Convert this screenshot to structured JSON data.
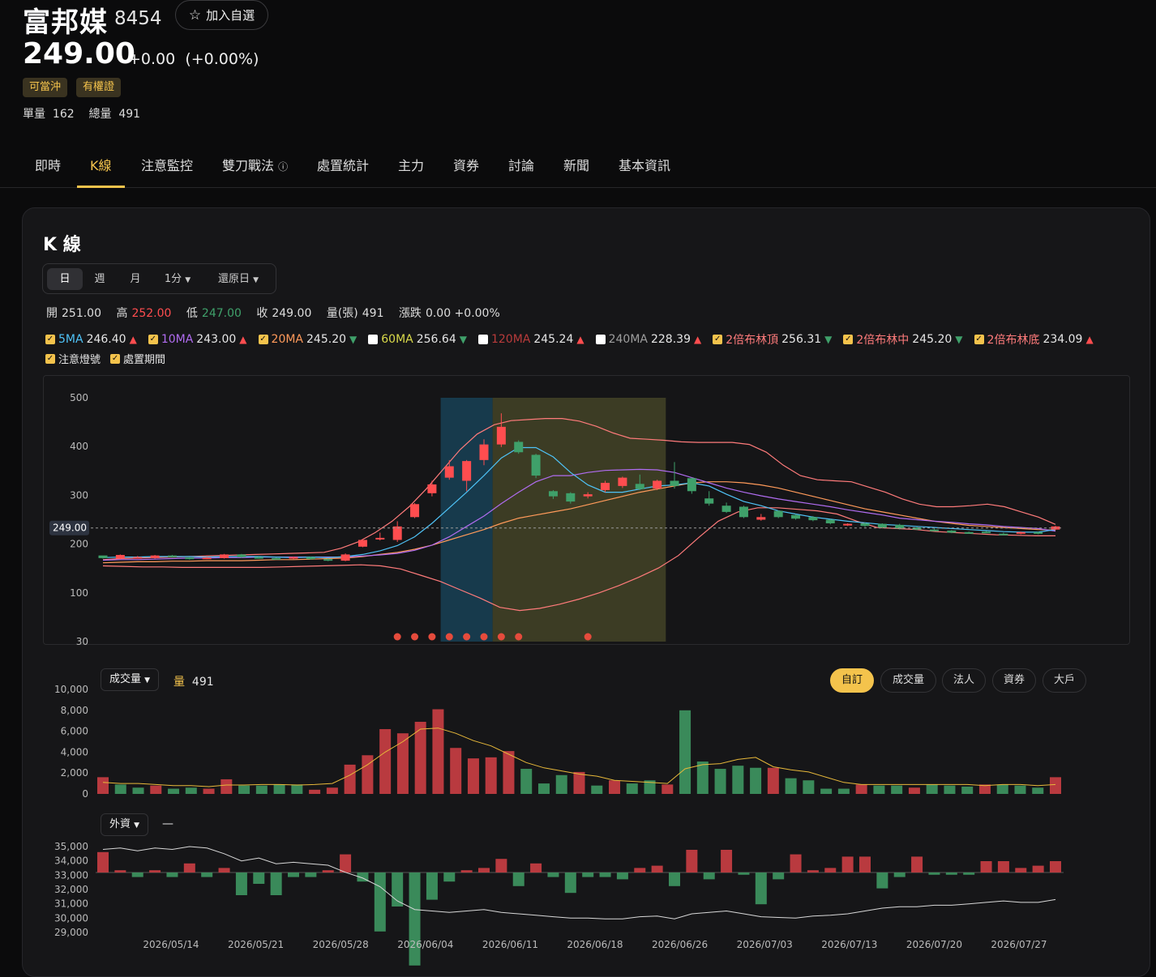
{
  "stock": {
    "name": "富邦媒",
    "code": "8454",
    "add_watch": "加入自選",
    "price": "249.00",
    "change": "+0.00",
    "change_pct": "(+0.00%)"
  },
  "badges": [
    "可當沖",
    "有權證"
  ],
  "volume": {
    "single_label": "單量",
    "single": "162",
    "total_label": "總量",
    "total": "491"
  },
  "tabs": [
    "即時",
    "K線",
    "注意監控",
    "雙刀戰法",
    "處置統計",
    "主力",
    "資券",
    "討論",
    "新聞",
    "基本資訊"
  ],
  "active_tab": "K線",
  "kline": {
    "title": "K 線",
    "periods": [
      "日",
      "週",
      "月",
      "1分",
      "還原日"
    ],
    "ohlc": {
      "open_label": "開",
      "open": "251.00",
      "high_label": "高",
      "high": "252.00",
      "low_label": "低",
      "low": "247.00",
      "close_label": "收",
      "close": "249.00",
      "vol_label": "量(張)",
      "vol": "491",
      "chg_label": "漲跌",
      "chg": "0.00 +0.00%"
    },
    "indicators": [
      {
        "name": "5MA",
        "value": "246.40",
        "dir": "up",
        "checked": true,
        "color": "#4fc3f7"
      },
      {
        "name": "10MA",
        "value": "243.00",
        "dir": "up",
        "checked": true,
        "color": "#b06cf0"
      },
      {
        "name": "20MA",
        "value": "245.20",
        "dir": "down",
        "checked": true,
        "color": "#ff9a5a"
      },
      {
        "name": "60MA",
        "value": "256.64",
        "dir": "down",
        "checked": false,
        "color": "#d9d94a"
      },
      {
        "name": "120MA",
        "value": "245.24",
        "dir": "up",
        "checked": false,
        "color": "#b83b3b"
      },
      {
        "name": "240MA",
        "value": "228.39",
        "dir": "up",
        "checked": false,
        "color": "#9e9e9e"
      },
      {
        "name": "2倍布林頂",
        "value": "256.31",
        "dir": "down",
        "checked": true,
        "color": "#ff7b7b"
      },
      {
        "name": "2倍布林中",
        "value": "245.20",
        "dir": "down",
        "checked": true,
        "color": "#ff7b7b"
      },
      {
        "name": "2倍布林底",
        "value": "234.09",
        "dir": "up",
        "checked": true,
        "color": "#ff7b7b"
      }
    ],
    "extra_toggles": [
      "注意燈號",
      "處置期間"
    ],
    "current_price_tag": "249.00"
  },
  "volume_panel": {
    "selector": "成交量",
    "label": "量",
    "value": "491",
    "tabs": [
      "自訂",
      "成交量",
      "法人",
      "資券",
      "大戶"
    ],
    "active": "自訂"
  },
  "foreign_panel": {
    "selector": "外資",
    "value": "—"
  },
  "colors": {
    "up": "#ff4d4f",
    "down": "#3fa06a",
    "accent": "#f4c34c",
    "band_warn": "#4a4a2a",
    "band_alert": "#173a4c"
  },
  "chart_data": [
    {
      "type": "candlestick",
      "y_ticks": [
        "500",
        "400",
        "300",
        "200",
        "100",
        "30"
      ],
      "x_labels": [
        "2026/05/14",
        "2026/05/21",
        "2026/05/28",
        "2026/06/04",
        "2026/06/11",
        "2026/06/18",
        "2026/06/26",
        "2026/07/03",
        "2026/07/13",
        "2026/07/20",
        "2026/07/27"
      ],
      "candles": [
        [
          196,
          191,
          194,
          190
        ],
        [
          190,
          197,
          198,
          189
        ],
        [
          193,
          193,
          195,
          191
        ],
        [
          191,
          196,
          197,
          190
        ],
        [
          196,
          194,
          197,
          192
        ],
        [
          192,
          190,
          193,
          188
        ],
        [
          190,
          192,
          193,
          189
        ],
        [
          191,
          198,
          199,
          190
        ],
        [
          198,
          193,
          199,
          191
        ],
        [
          193,
          191,
          194,
          190
        ],
        [
          191,
          190,
          192,
          189
        ],
        [
          190,
          193,
          194,
          189
        ],
        [
          193,
          189,
          194,
          188
        ],
        [
          189,
          186,
          190,
          185
        ],
        [
          186,
          198,
          200,
          185
        ],
        [
          213,
          226,
          228,
          212
        ],
        [
          228,
          230,
          240,
          225
        ],
        [
          226,
          252,
          262,
          222
        ],
        [
          270,
          295,
          297,
          268
        ],
        [
          316,
          333,
          340,
          310
        ],
        [
          346,
          368,
          380,
          342
        ],
        [
          340,
          378,
          380,
          320
        ],
        [
          380,
          410,
          420,
          370
        ],
        [
          410,
          444,
          470,
          405
        ],
        [
          415,
          395,
          418,
          392
        ],
        [
          390,
          350,
          392,
          345
        ],
        [
          320,
          310,
          322,
          305
        ],
        [
          316,
          300,
          318,
          296
        ],
        [
          310,
          314,
          318,
          306
        ],
        [
          322,
          336,
          340,
          318
        ],
        [
          330,
          346,
          348,
          326
        ],
        [
          334,
          324,
          352,
          322
        ],
        [
          325,
          340,
          342,
          322
        ],
        [
          340,
          330,
          376,
          325
        ],
        [
          345,
          320,
          346,
          315
        ],
        [
          306,
          296,
          320,
          292
        ],
        [
          292,
          280,
          298,
          278
        ],
        [
          290,
          270,
          292,
          268
        ],
        [
          265,
          270,
          276,
          263
        ],
        [
          282,
          270,
          283,
          268
        ],
        [
          274,
          267,
          276,
          265
        ],
        [
          270,
          264,
          272,
          262
        ],
        [
          265,
          258,
          266,
          256
        ],
        [
          255,
          257,
          258,
          253
        ],
        [
          258,
          253,
          260,
          251
        ],
        [
          257,
          250,
          258,
          248
        ],
        [
          255,
          248,
          257,
          246
        ],
        [
          250,
          246,
          251,
          245
        ],
        [
          246,
          244,
          248,
          243
        ],
        [
          244,
          240,
          245,
          239
        ],
        [
          241,
          240,
          242,
          238
        ],
        [
          242,
          241,
          243,
          240
        ],
        [
          238,
          236,
          240,
          235
        ],
        [
          239,
          241,
          242,
          237
        ],
        [
          241,
          238,
          242,
          237
        ],
        [
          246,
          252,
          253,
          245
        ]
      ],
      "alert_dots_at": [
        17,
        18,
        19,
        20,
        21,
        22,
        23,
        24,
        28
      ],
      "alert_band": [
        20,
        22
      ],
      "disposal_band": [
        23,
        32
      ],
      "ma5": [
        192,
        193,
        193,
        194,
        194,
        194,
        193,
        194,
        194,
        194,
        193,
        192,
        193,
        192,
        194,
        198,
        205,
        215,
        232,
        258,
        288,
        318,
        350,
        384,
        404,
        404,
        386,
        356,
        332,
        318,
        318,
        324,
        330,
        332,
        336,
        330,
        314,
        300,
        292,
        282,
        276,
        270,
        266,
        262,
        259,
        256,
        254,
        252,
        250,
        248,
        246,
        244,
        242,
        241,
        241,
        246
      ],
      "ma10": [
        187,
        188,
        188,
        189,
        190,
        191,
        191,
        192,
        192,
        193,
        193,
        193,
        193,
        193,
        193,
        195,
        197,
        200,
        206,
        216,
        232,
        252,
        272,
        296,
        318,
        338,
        350,
        350,
        356,
        360,
        361,
        362,
        361,
        356,
        346,
        336,
        326,
        318,
        311,
        305,
        300,
        295,
        290,
        284,
        279,
        274,
        268,
        265,
        262,
        260,
        257,
        255,
        252,
        250,
        248,
        243
      ],
      "ma20": [
        182,
        183,
        184,
        184,
        185,
        185,
        186,
        186,
        186,
        187,
        188,
        188,
        189,
        190,
        191,
        194,
        198,
        202,
        208,
        216,
        226,
        236,
        246,
        258,
        268,
        274,
        280,
        286,
        294,
        302,
        310,
        318,
        324,
        330,
        336,
        338,
        338,
        336,
        332,
        326,
        318,
        310,
        302,
        294,
        286,
        280,
        274,
        268,
        262,
        258,
        254,
        252,
        250,
        248,
        246,
        245
      ],
      "boll_up": [
        188,
        190,
        191,
        192,
        193,
        194,
        195,
        196,
        197,
        198,
        199,
        200,
        201,
        202,
        210,
        222,
        240,
        262,
        290,
        324,
        362,
        400,
        430,
        448,
        456,
        458,
        460,
        460,
        455,
        445,
        432,
        422,
        420,
        418,
        415,
        414,
        414,
        414,
        410,
        395,
        370,
        350,
        342,
        340,
        338,
        328,
        318,
        305,
        295,
        290,
        290,
        292,
        295,
        290,
        280,
        270,
        256
      ],
      "boll_low": [
        176,
        175,
        174,
        174,
        173,
        173,
        173,
        173,
        173,
        174,
        175,
        176,
        177,
        178,
        176,
        170,
        158,
        146,
        130,
        114,
        96,
        90,
        94,
        102,
        112,
        124,
        138,
        154,
        172,
        196,
        230,
        262,
        280,
        288,
        288,
        285,
        282,
        276,
        262,
        250,
        248,
        246,
        242,
        240,
        238,
        236,
        235,
        234,
        234
      ],
      "ylim": [
        30,
        500
      ]
    },
    {
      "type": "bar",
      "name": "成交量",
      "y_ticks": [
        "10,000",
        "8,000",
        "6,000",
        "4,000",
        "2,000",
        "0"
      ],
      "values": [
        1600,
        900,
        600,
        800,
        500,
        600,
        500,
        1400,
        800,
        800,
        900,
        900,
        400,
        600,
        2800,
        3700,
        6200,
        5800,
        6900,
        8100,
        4400,
        3400,
        3500,
        4100,
        2400,
        1000,
        1800,
        2100,
        800,
        1300,
        1000,
        1300,
        900,
        8000,
        3100,
        2400,
        2700,
        2500,
        2500,
        1500,
        1300,
        500,
        500,
        900,
        800,
        800,
        600,
        900,
        800,
        700,
        900,
        900,
        800,
        600,
        1600
      ],
      "up": [
        1,
        0,
        0,
        1,
        0,
        0,
        1,
        1,
        0,
        0,
        0,
        0,
        1,
        1,
        1,
        1,
        1,
        1,
        1,
        1,
        1,
        1,
        1,
        1,
        0,
        0,
        0,
        1,
        0,
        1,
        0,
        0,
        1,
        0,
        0,
        0,
        0,
        0,
        1,
        0,
        0,
        0,
        0,
        1,
        0,
        0,
        1,
        0,
        0,
        0,
        1,
        0,
        0,
        0,
        1
      ],
      "ma": [
        1100,
        1000,
        1000,
        900,
        800,
        800,
        700,
        850,
        850,
        900,
        900,
        850,
        900,
        1000,
        1800,
        2800,
        4000,
        5000,
        6200,
        6300,
        5800,
        5100,
        4600,
        3800,
        3000,
        2500,
        2200,
        1900,
        1700,
        1300,
        1200,
        1100,
        1000,
        2400,
        2800,
        2900,
        3300,
        3500,
        2600,
        2300,
        2100,
        1600,
        1100,
        900,
        900,
        900,
        900,
        900,
        900,
        900,
        800,
        900,
        900,
        800,
        900
      ],
      "ylim": [
        0,
        10000
      ]
    },
    {
      "type": "bar",
      "name": "外資",
      "y_ticks": [
        "35,000",
        "34,000",
        "33,000",
        "32,000",
        "31,000",
        "30,000",
        "29,000"
      ],
      "values": [
        900,
        100,
        -200,
        100,
        -200,
        400,
        -200,
        200,
        -1000,
        -500,
        -1000,
        -200,
        -200,
        100,
        800,
        -400,
        -2600,
        -1500,
        -4100,
        -1200,
        -400,
        100,
        200,
        600,
        -600,
        400,
        -200,
        -900,
        -200,
        -200,
        -300,
        200,
        300,
        -600,
        1000,
        -300,
        1000,
        -100,
        -1400,
        -300,
        800,
        100,
        200,
        700,
        700,
        -700,
        -200,
        700,
        -100,
        -100,
        -100,
        500,
        500,
        200,
        300,
        500
      ],
      "line": [
        34800,
        34900,
        34700,
        34900,
        34800,
        35000,
        34900,
        34500,
        34000,
        34200,
        33800,
        33900,
        33800,
        33700,
        33200,
        32800,
        32200,
        31200,
        30600,
        30500,
        30400,
        30500,
        30600,
        30400,
        30300,
        30200,
        30100,
        30000,
        30000,
        29950,
        29950,
        30100,
        30150,
        29950,
        30300,
        30400,
        30500,
        30300,
        30100,
        30050,
        30000,
        30150,
        30200,
        30300,
        30500,
        30700,
        30800,
        30800,
        30900,
        30900,
        31000,
        31100,
        31200,
        31100,
        31100,
        31300
      ],
      "ylim": [
        29000,
        35000
      ]
    }
  ]
}
